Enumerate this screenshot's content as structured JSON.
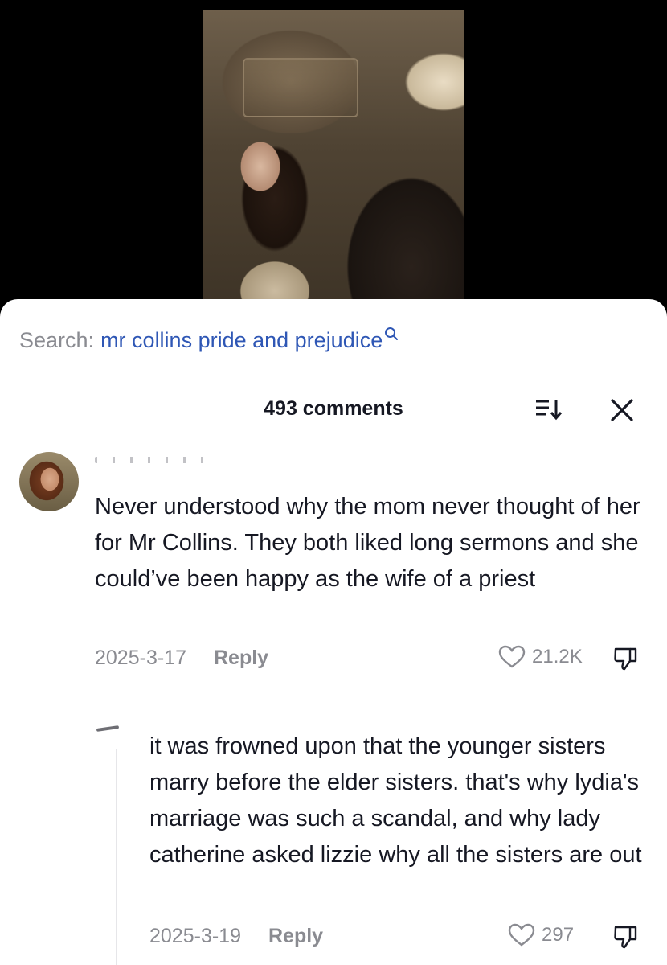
{
  "search": {
    "prefix": "Search:",
    "query": "mr collins pride and prejudice"
  },
  "header": {
    "comment_count": "493 comments"
  },
  "comments": [
    {
      "text": "Never understood why the mom never thought of her for Mr Collins. They both liked long sermons and she could’ve been happy as the wife of a priest",
      "date": "2025-3-17",
      "reply_label": "Reply",
      "likes": "21.2K"
    }
  ],
  "replies": [
    {
      "text": "it was frowned upon that the younger sisters marry before the elder sisters. that's why lydia's marriage was such a scandal, and why lady catherine asked lizzie why all the sisters are out",
      "date": "2025-3-19",
      "reply_label": "Reply",
      "likes": "297"
    }
  ],
  "icons": {
    "search": "search-icon",
    "sort": "sort-icon",
    "close": "close-icon",
    "like": "heart-icon",
    "dislike": "dislike-icon"
  },
  "colors": {
    "link_blue": "#2f57b5",
    "muted_gray": "#8a8b91",
    "text_dark": "#161823"
  }
}
